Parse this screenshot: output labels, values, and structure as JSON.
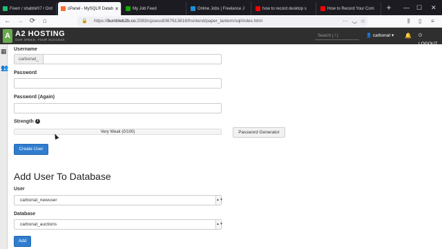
{
  "browser": {
    "tabs": [
      {
        "title": "Fiverr / shabbir07 / Ord",
        "favicon_color": "#1dbf73",
        "active": false
      },
      {
        "title": "cPanel - MySQL® Datab",
        "favicon_color": "#ff6c2c",
        "active": true
      },
      {
        "title": "My Job Feed",
        "favicon_color": "#14a800",
        "active": false
      },
      {
        "title": "Online Jobs | Freelance J",
        "favicon_color": "#1a8fd6",
        "active": false
      },
      {
        "title": "how to record desktop s",
        "favicon_color": "#ff0000",
        "active": false
      },
      {
        "title": "How to Record Your Com",
        "favicon_color": "#ff0000",
        "active": false
      }
    ],
    "new_tab": "+",
    "window_controls": [
      "—",
      "☐",
      "✕"
    ],
    "url": {
      "prefix": "https://",
      "domain": "bumbleb2b.co",
      "rest": ":2083/cpsess8367613616/frontend/paper_lantern/sql/index.html"
    }
  },
  "cpanel": {
    "logo_mark": "A",
    "logo_text": "A2 HOSTING",
    "logo_tagline": "OUR SPEED, YOUR SUCCESS",
    "search_placeholder": "Search ( / )",
    "username": "carbonat",
    "logout_label": "LOGOUT"
  },
  "form": {
    "username_label": "Username",
    "username_prefix": "carbonat_",
    "username_value": "",
    "password_label": "Password",
    "password_again_label": "Password (Again)",
    "strength_label": "Strength",
    "strength_value": "Very Weak (0/100)",
    "strength_level": 0,
    "password_generator": "Password Generator",
    "create_user": "Create User"
  },
  "add_user": {
    "heading": "Add User To Database",
    "user_label": "User",
    "user_selected": "carbonat_newuser",
    "database_label": "Database",
    "database_selected": "carbonat_auctions",
    "add_button": "Add"
  }
}
